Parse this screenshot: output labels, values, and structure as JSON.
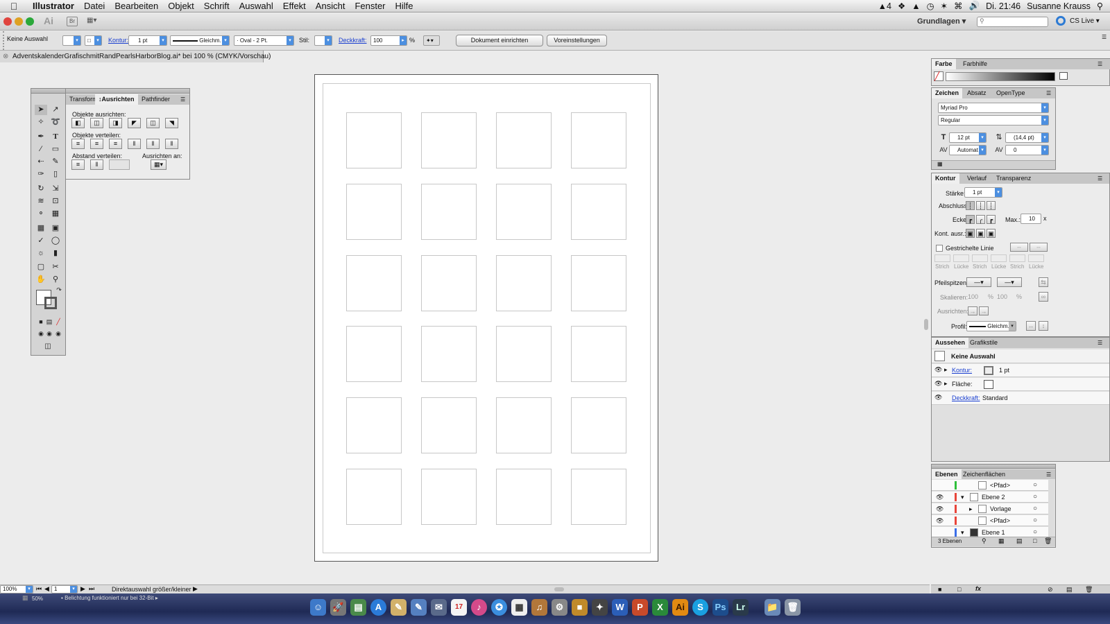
{
  "menubar": {
    "app": "Illustrator",
    "items": [
      "Datei",
      "Bearbeiten",
      "Objekt",
      "Schrift",
      "Auswahl",
      "Effekt",
      "Ansicht",
      "Fenster",
      "Hilfe"
    ],
    "status_adobe": "4",
    "clock": "Di. 21:46",
    "user": "Susanne Krauss"
  },
  "apptoolbar": {
    "workspace": "Grundlagen",
    "cslive": "CS Live",
    "ai_logo": "Ai",
    "br_label": "Br"
  },
  "control": {
    "selection": "Keine Auswahl",
    "kontur_label": "Kontur:",
    "kontur_value": "1 pt",
    "stroke_style": "Gleichm.",
    "brush": "Oval - 2 Pt.",
    "stil_label": "Stil:",
    "opacity_label": "Deckkraft:",
    "opacity_value": "100",
    "percent": "%",
    "doc_setup": "Dokument einrichten",
    "prefs": "Voreinstellungen"
  },
  "document": {
    "tab_title": "AdventskalenderGrafischmitRandPearlsHarborBlog.ai* bei 100 % (CMYK/Vorschau)"
  },
  "align_panel": {
    "tabs": [
      "Transform",
      "Ausrichten",
      "Pathfinder"
    ],
    "align_objects": "Objekte ausrichten:",
    "distribute_objects": "Objekte verteilen:",
    "distribute_spacing": "Abstand verteilen:",
    "align_to": "Ausrichten an:"
  },
  "color_panel": {
    "tabs": [
      "Farbe",
      "Farbhilfe"
    ]
  },
  "character_panel": {
    "tabs": [
      "Zeichen",
      "Absatz",
      "OpenType"
    ],
    "font": "Myriad Pro",
    "style": "Regular",
    "size": "12 pt",
    "leading": "(14,4 pt)",
    "kerning": "Automat",
    "tracking": "0"
  },
  "stroke_panel": {
    "tabs": [
      "Kontur",
      "Verlauf",
      "Transparenz"
    ],
    "weight_label": "Stärke:",
    "weight": "1 pt",
    "cap_label": "Abschluss:",
    "corner_label": "Ecke:",
    "limit_label": "Max.:",
    "limit": "10",
    "limit_unit": "x",
    "align_label": "Kont. ausr.:",
    "dashed_label": "Gestrichelte Linie",
    "dash_labels": [
      "Strich",
      "Lücke",
      "Strich",
      "Lücke",
      "Strich",
      "Lücke"
    ],
    "arrows_label": "Pfeilspitzen:",
    "scale_label": "Skalieren:",
    "scale_a": "100",
    "scale_b": "100",
    "scale_pct": "%",
    "align_arrows_label": "Ausrichten:",
    "profile_label": "Profil:",
    "profile": "Gleichm."
  },
  "appearance_panel": {
    "tabs": [
      "Aussehen",
      "Grafikstile"
    ],
    "title": "Keine Auswahl",
    "stroke_label": "Kontur:",
    "stroke_value": "1 pt",
    "fill_label": "Fläche:",
    "opacity_label": "Deckkraft:",
    "opacity_value": "Standard"
  },
  "layers_panel": {
    "tabs": [
      "Ebenen",
      "Zeichenflächen"
    ],
    "rows": [
      "<Pfad>",
      "Ebene 2",
      "Vorlage",
      "<Pfad>",
      "Ebene 1"
    ],
    "footer": "3 Ebenen",
    "colors": [
      "#2fbf3a",
      "#e8453a",
      "#e8453a",
      "#e8453a",
      "#3a6ee8"
    ]
  },
  "statusbar": {
    "zoom": "100%",
    "page": "1",
    "tool": "Direktauswahl größer/kleiner",
    "zoom2": "50%",
    "msg": "Belichtung funktioniert nur bei 32-Bit"
  },
  "grid": {
    "rows": 6,
    "cols": 4
  },
  "colors": {
    "accent": "#4c8fe0",
    "link": "#1a3fd0"
  },
  "dock": {
    "icons": [
      "finder-icon",
      "launchpad-icon",
      "preview-icon",
      "appstore-icon",
      "notes-icon",
      "pages-icon",
      "mail-icon",
      "calendar-icon",
      "itunes-icon",
      "safari-icon",
      "grid-icon",
      "guitar-icon",
      "settings-icon",
      "photos-icon",
      "fluid-icon",
      "word-icon",
      "powerpoint-icon",
      "excel-icon",
      "illustrator-icon",
      "skype-icon",
      "photoshop-icon",
      "lightroom-icon",
      "downloads-icon",
      "trash-icon"
    ],
    "calendar_day": "17",
    "word": "W",
    "powerpoint": "P",
    "excel": "X",
    "illustrator": "Ai",
    "skype": "S",
    "photoshop": "Ps",
    "lightroom": "Lr"
  }
}
